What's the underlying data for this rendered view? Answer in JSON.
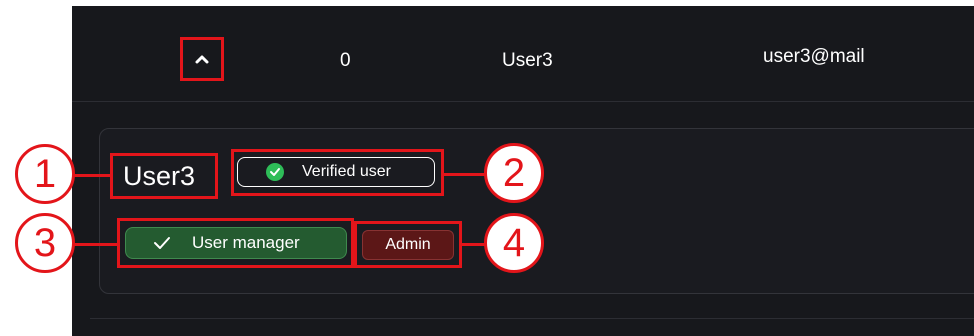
{
  "users_table": {
    "row": {
      "expand_icon": "chevron-up-icon",
      "index": "0",
      "name": "User3",
      "email": "user3@mail"
    }
  },
  "user_details": {
    "title": "User3",
    "verified_badge": {
      "label": "Verified user",
      "icon": "check-circle-icon",
      "icon_color": "#2ebd58"
    },
    "roles": [
      {
        "label": "User manager",
        "icon": "check-icon",
        "color": "#245b30"
      },
      {
        "label": "Admin",
        "color": "#5c1717"
      }
    ]
  },
  "callouts": [
    "1",
    "2",
    "3",
    "4"
  ],
  "colors": {
    "background": "#17181c",
    "highlight": "#e3151a"
  }
}
